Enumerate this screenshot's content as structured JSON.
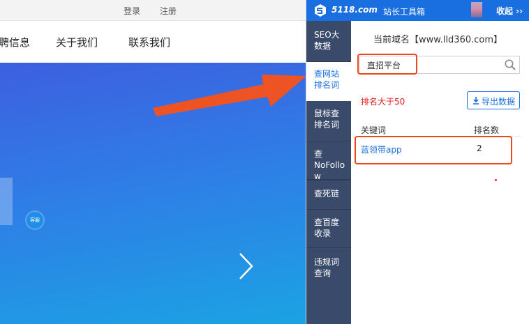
{
  "website": {
    "topbar": {
      "login": "登录",
      "register": "注册"
    },
    "nav": [
      {
        "label": "聘信息",
        "id": "jobs"
      },
      {
        "label": "关于我们",
        "id": "about"
      },
      {
        "label": "联系我们",
        "id": "contact"
      }
    ],
    "hero": {
      "badge_text": "客服",
      "next_icon": "chevron-right-icon"
    }
  },
  "extension": {
    "brand": "5118.com",
    "brand_subtitle": "站长工具箱",
    "collapse_label": "收起 ››",
    "colors": {
      "header": "#1a6fe0",
      "sidebar": "#3a4a6a",
      "accent": "#1a6fe0",
      "warning": "#e01e1e",
      "highlight": "#e84a1c"
    },
    "menu": [
      {
        "label": "SEO大数据",
        "active": false
      },
      {
        "label": "查网站排名词",
        "active": true
      },
      {
        "label": "鼠标查排名词",
        "active": false
      },
      {
        "label": "查NoFollow",
        "active": false
      },
      {
        "label": "查死链",
        "active": false
      },
      {
        "label": "查百度收录",
        "active": false
      },
      {
        "label": "违规词查询",
        "active": false
      }
    ],
    "domain_label": "当前域名【www.lld360.com】",
    "search": {
      "value": "直招平台",
      "icon": "search-icon"
    },
    "filter_text": "排名大于50",
    "export_label": "导出数据",
    "table": {
      "headers": [
        "关键词",
        "排名数"
      ],
      "rows": [
        {
          "keyword": "蓝领带app",
          "rank": "2"
        }
      ]
    }
  }
}
